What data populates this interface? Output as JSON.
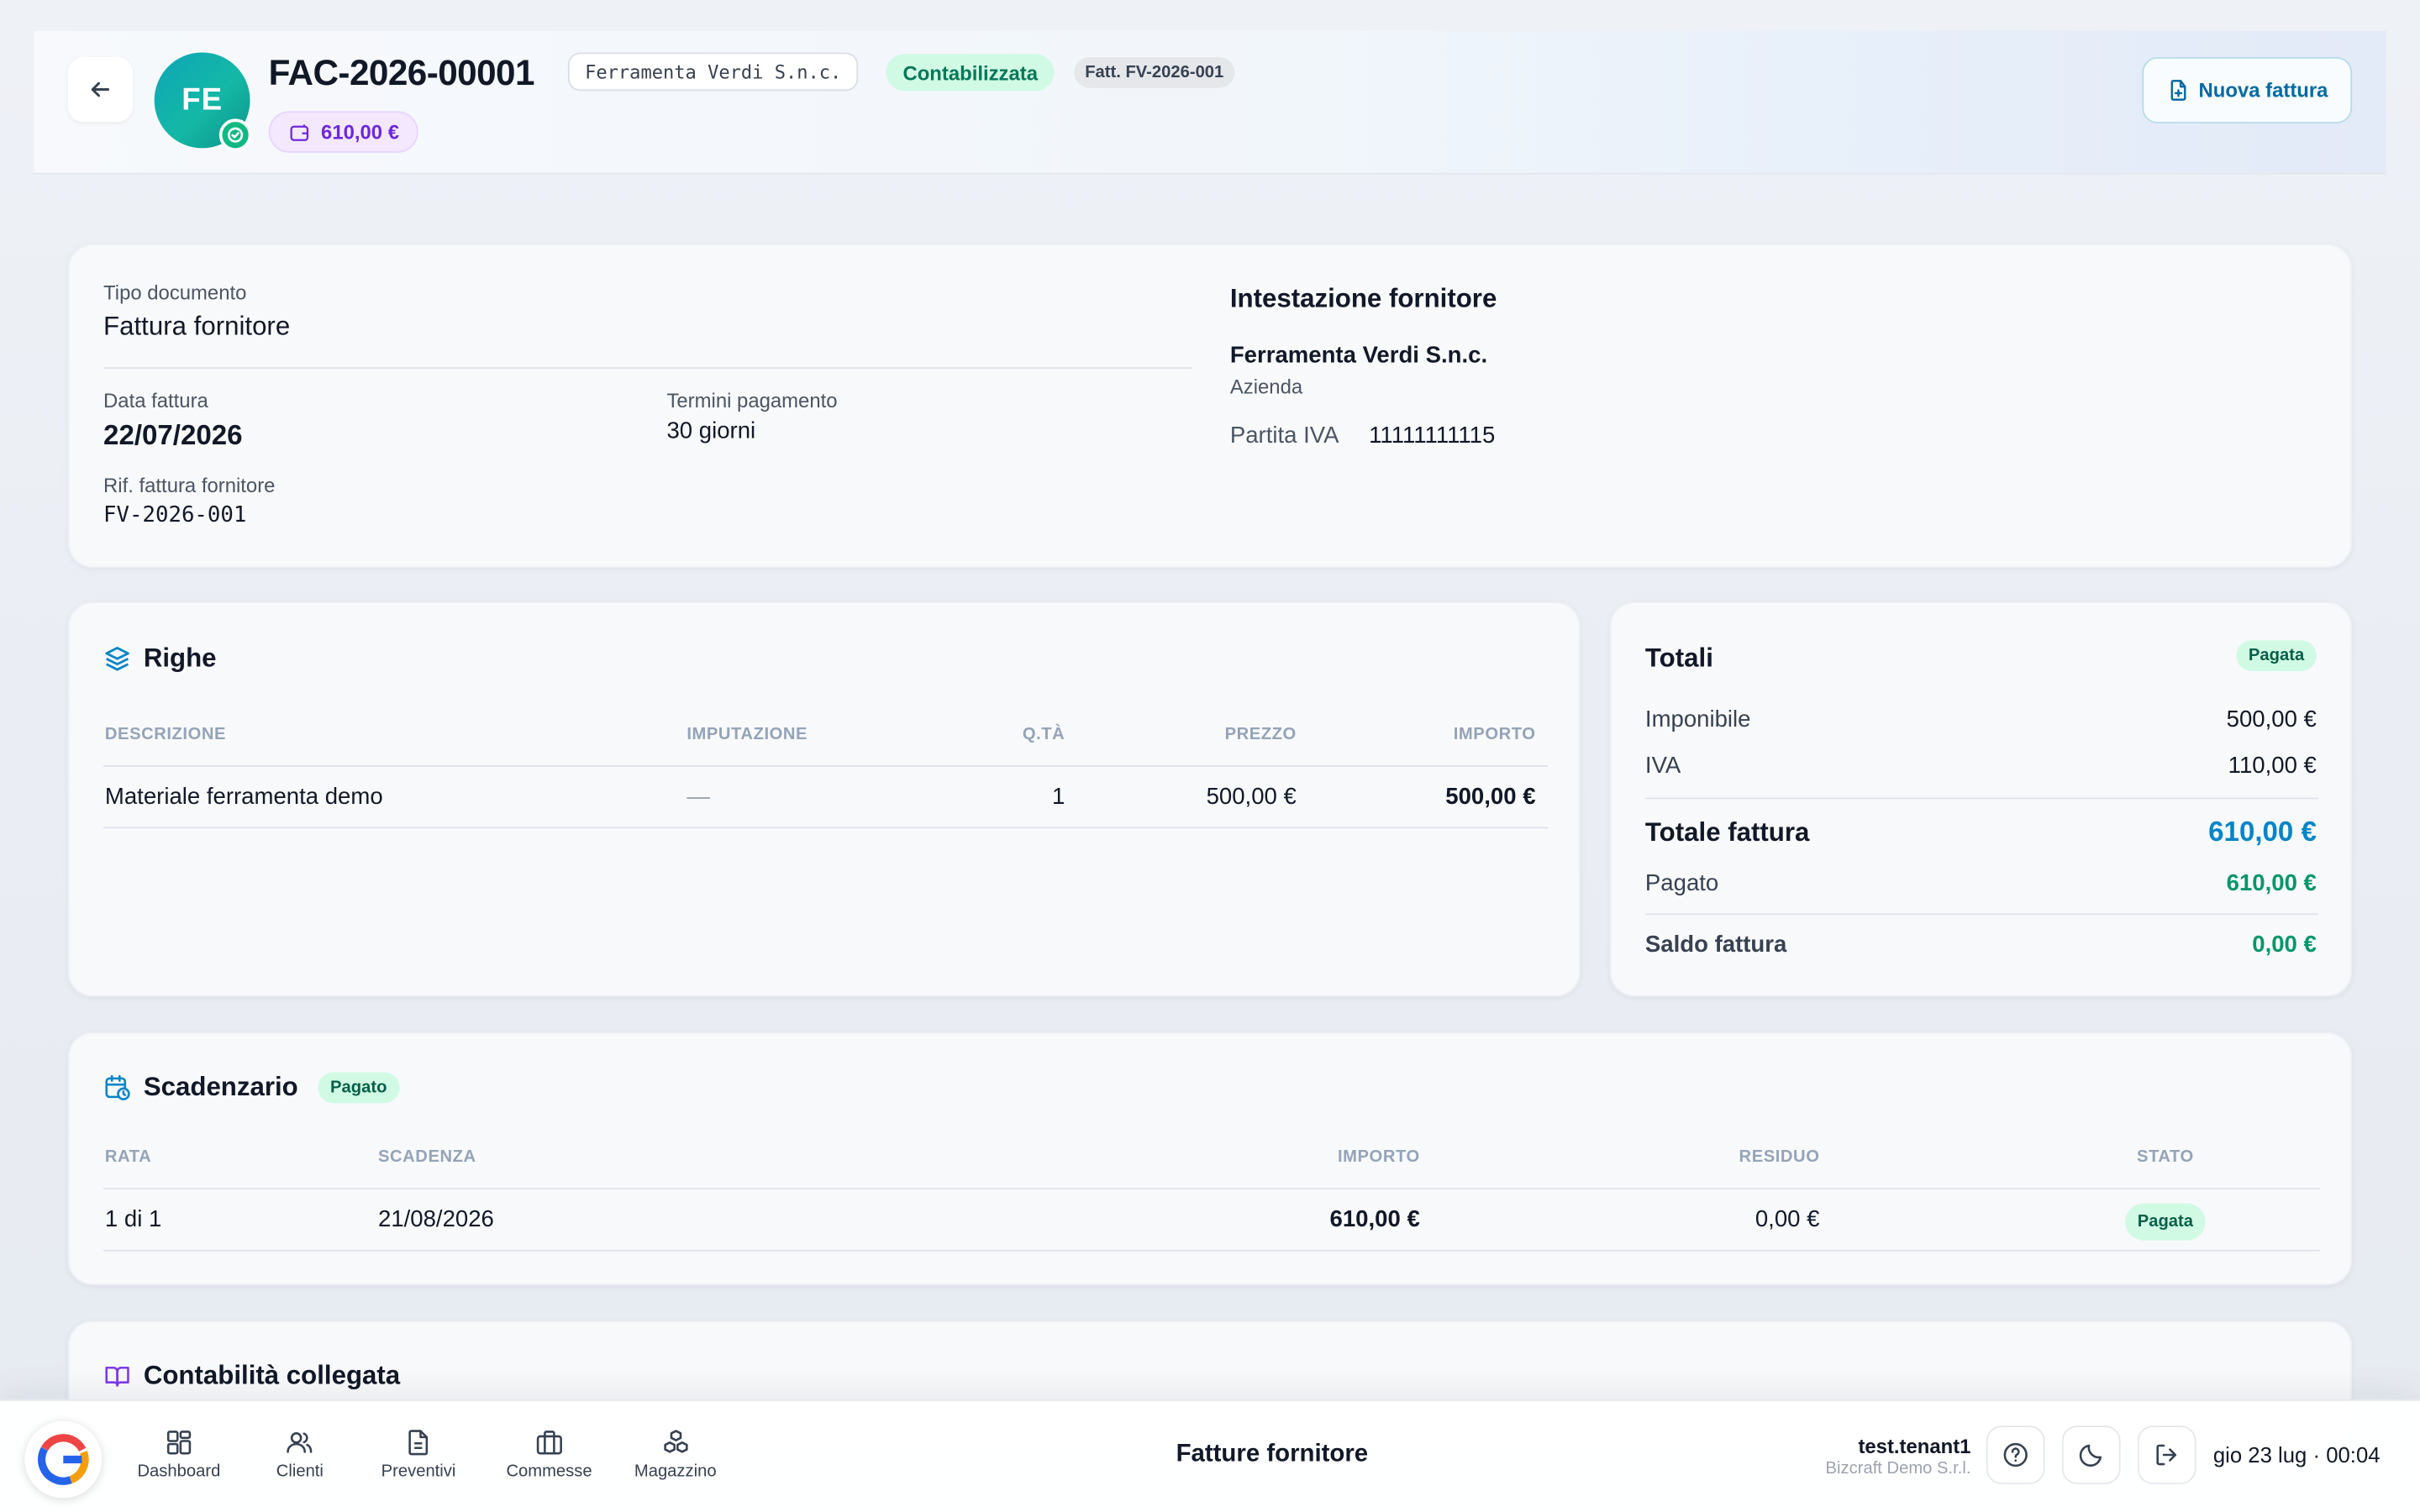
{
  "header": {
    "back_icon": "arrow-left-icon",
    "avatar_initials": "FE",
    "doc_number": "FAC-2026-00001",
    "supplier_chip": "Ferramenta Verdi S.n.c.",
    "status": "Contabilizzata",
    "ref_chip": "Fatt. FV-2026-001",
    "amount_chip": "610,00 €",
    "new_button": "Nuova fattura"
  },
  "info": {
    "doc_type_label": "Tipo documento",
    "doc_type_value": "Fattura fornitore",
    "date_label": "Data fattura",
    "date_value": "22/07/2026",
    "terms_label": "Termini pagamento",
    "terms_value": "30 giorni",
    "ref_label": "Rif. fattura fornitore",
    "ref_value": "FV-2026-001",
    "supplier_title": "Intestazione fornitore",
    "supplier_name": "Ferramenta Verdi S.n.c.",
    "supplier_type": "Azienda",
    "vat_label": "Partita IVA",
    "vat_value": "11111111115"
  },
  "righe": {
    "title": "Righe",
    "columns": [
      "DESCRIZIONE",
      "IMPUTAZIONE",
      "Q.TÀ",
      "PREZZO",
      "IMPORTO"
    ],
    "rows": [
      {
        "descrizione": "Materiale ferramenta demo",
        "imputazione": "—",
        "qta": "1",
        "prezzo": "500,00 €",
        "importo": "500,00 €"
      }
    ]
  },
  "totali": {
    "title": "Totali",
    "badge": "Pagata",
    "imponibile_label": "Imponibile",
    "imponibile_value": "500,00 €",
    "iva_label": "IVA",
    "iva_value": "110,00 €",
    "totale_label": "Totale fattura",
    "totale_value": "610,00 €",
    "pagato_label": "Pagato",
    "pagato_value": "610,00 €",
    "saldo_label": "Saldo fattura",
    "saldo_value": "0,00 €"
  },
  "scadenzario": {
    "title": "Scadenzario",
    "badge": "Pagato",
    "columns": [
      "RATA",
      "SCADENZA",
      "IMPORTO",
      "RESIDUO",
      "STATO"
    ],
    "rows": [
      {
        "rata": "1 di 1",
        "scadenza": "21/08/2026",
        "importo": "610,00 €",
        "residuo": "0,00 €",
        "stato": "Pagata"
      }
    ]
  },
  "contabilita": {
    "title": "Contabilità collegata"
  },
  "bottom": {
    "nav": [
      "Dashboard",
      "Clienti",
      "Preventivi",
      "Commesse",
      "Magazzino"
    ],
    "page_title": "Fatture fornitore",
    "user_name": "test.tenant1",
    "user_org": "Bizcraft Demo S.r.l.",
    "datetime": "gio 23 lug · 00:04"
  },
  "colors": {
    "accent": "#0284c7",
    "success": "#059669",
    "status_bg": "#d1fae5",
    "purple": "#6d28d9"
  }
}
